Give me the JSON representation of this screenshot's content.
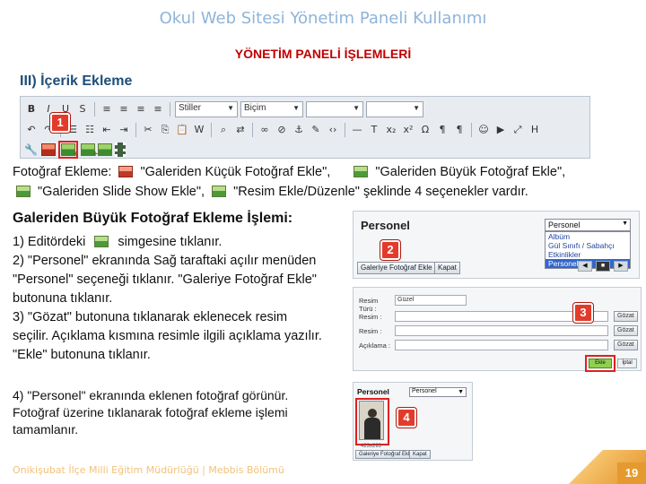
{
  "header": {
    "title": "Okul Web Sitesi Yönetim Paneli Kullanımı",
    "subtitle": "YÖNETİM PANELİ İŞLEMLERİ",
    "section": "III) İçerik Ekleme"
  },
  "toolbar": {
    "select_style": "Stiller",
    "select_format": "Biçim"
  },
  "markers": {
    "m1": "1",
    "m2": "2",
    "m3": "3",
    "m4": "4"
  },
  "intro": {
    "line1_prefix": "Fotoğraf Ekleme:",
    "opt1": "\"Galeriden Küçük Fotoğraf Ekle\",",
    "opt2": "\"Galeriden Büyük Fotoğraf Ekle\",",
    "opt3": "\"Galeriden Slide Show Ekle\",",
    "opt4": "\"Resim Ekle/Düzenle\" şeklinde 4 seçenekler vardır."
  },
  "steps": {
    "heading": "Galeriden Büyük Fotoğraf Ekleme İşlemi:",
    "s1a": "1) Editördeki",
    "s1b": "simgesine tıklanır.",
    "s2a": "2) \"Personel\" ekranında Sağ taraftaki açılır menüden",
    "s2b": "\"Personel\" seçeneği tıklanır. \"Galeriye Fotoğraf Ekle\"",
    "s2c": "butonuna tıklanır.",
    "s3a": "3) \"Gözat\" butonuna tıklanarak eklenecek resim",
    "s3b": "seçilir. Açıklama kısmına resimle ilgili açıklama yazılır.",
    "s3c": "\"Ekle\" butonuna tıklanır.",
    "s4a": "4) \"Personel\" ekranında eklenen fotoğraf görünür.",
    "s4b": "Fotoğraf üzerine tıklanarak fotoğraf ekleme işlemi",
    "s4c": "tamamlanır."
  },
  "panel1": {
    "title": "Personel",
    "dropdown_value": "Personel",
    "options": [
      "Albüm",
      "Gül Sınıfı / Sabahçı",
      "Etkinlikler",
      "Personel"
    ],
    "add_button": "Galeriye Fotoğraf Ekle",
    "close_button": "Kapat"
  },
  "panel2": {
    "rows": [
      {
        "label": "Resim Türü :",
        "value": "Güzel",
        "button": ""
      },
      {
        "label": "Resim :",
        "value": "",
        "button": "Gözat"
      },
      {
        "label": "Resim :",
        "value": "",
        "button": "Gözat"
      },
      {
        "label": "Açıklama :",
        "value": "",
        "button": "Gözat"
      }
    ],
    "ok": "Ekle",
    "cancel": "İptal"
  },
  "panel3": {
    "title": "Personel",
    "dropdown_value": "Personel",
    "caption": "423x293",
    "add_button": "Galeriye Fotoğraf Ekle",
    "close_button": "Kapat"
  },
  "footer": {
    "text": "Onikişubat İlçe Milli Eğitim Müdürlüğü | Mebbis Bölümü",
    "page": "19"
  }
}
